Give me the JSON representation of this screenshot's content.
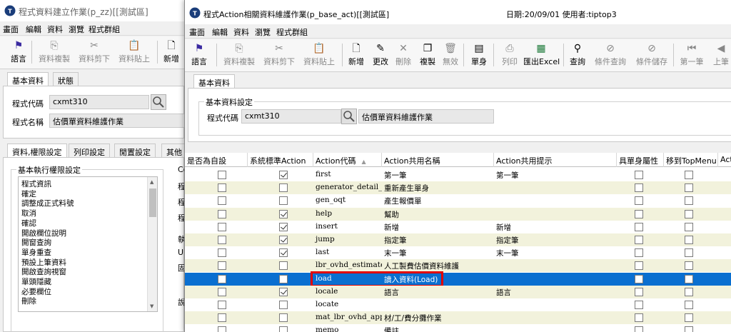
{
  "back_window": {
    "title": "程式資料建立作業(p_zz)[[測試區]",
    "menu": [
      "畫面",
      "編輯",
      "資料",
      "瀏覽",
      "程式群組"
    ],
    "toolbar": [
      {
        "label": "語言",
        "icon": "flag-icon"
      },
      {
        "label": "資料複製",
        "icon": "copy-icon"
      },
      {
        "label": "資料剪下",
        "icon": "cut-icon"
      },
      {
        "label": "資料貼上",
        "icon": "paste-icon"
      },
      {
        "label": "新增",
        "icon": "new-doc-icon"
      }
    ],
    "top_tabs": [
      "基本資料",
      "狀態"
    ],
    "program_code_label": "程式代碼",
    "program_code_value": "cxmt310",
    "program_name_label": "程式名稱",
    "program_name_value": "估價單資料維護作業",
    "lower_tabs": [
      "資料,權限設定",
      "列印設定",
      "閒置設定",
      "其他"
    ],
    "group_title": "基本執行權限設定",
    "permission_list": [
      "程式資訊",
      "確定",
      "調整成正式料號",
      "取消",
      "確認",
      "開啟欄位說明",
      "開窗查詢",
      "單身重查",
      "預設上筆資料",
      "開啟查詢視窗",
      "單頭隱藏",
      "必要欄位",
      "刪除"
    ],
    "side_labels": [
      "Co",
      "程",
      "程",
      "程",
      "執",
      "UI",
      "固",
      "說"
    ]
  },
  "front_window": {
    "title": "程式Action相關資料維護作業(p_base_act)[[測試區]",
    "date_user": "日期:20/09/01  使用者:tiptop3",
    "menu": [
      "畫面",
      "編輯",
      "資料",
      "瀏覽",
      "程式群組"
    ],
    "toolbar": [
      {
        "label": "語言",
        "icon": "flag-icon",
        "enabled": true
      },
      {
        "label": "資料複製",
        "icon": "copy-icon",
        "enabled": false
      },
      {
        "label": "資料剪下",
        "icon": "cut-icon",
        "enabled": false
      },
      {
        "label": "資料貼上",
        "icon": "paste-icon",
        "enabled": false
      },
      {
        "label": "新增",
        "icon": "new-doc-icon",
        "enabled": true
      },
      {
        "label": "更改",
        "icon": "pencil-icon",
        "enabled": true
      },
      {
        "label": "刪除",
        "icon": "x-icon",
        "enabled": false
      },
      {
        "label": "複製",
        "icon": "duplicate-icon",
        "enabled": true
      },
      {
        "label": "無效",
        "icon": "trash-icon",
        "enabled": false
      },
      {
        "label": "單身",
        "icon": "detail-icon",
        "enabled": true
      },
      {
        "label": "列印",
        "icon": "printer-icon",
        "enabled": false
      },
      {
        "label": "匯出Excel",
        "icon": "excel-icon",
        "enabled": true
      },
      {
        "label": "查詢",
        "icon": "binoculars-icon",
        "enabled": true
      },
      {
        "label": "條件查詢",
        "icon": "filter-icon",
        "enabled": false
      },
      {
        "label": "條件儲存",
        "icon": "filter-save-icon",
        "enabled": false
      },
      {
        "label": "第一筆",
        "icon": "first-icon",
        "enabled": false
      },
      {
        "label": "上筆",
        "icon": "prev-icon",
        "enabled": false
      }
    ],
    "tab": "基本資料",
    "group_title": "基本資料設定",
    "program_code_label": "程式代碼",
    "program_code_value": "cxmt310",
    "program_name_value": "估價單資料維護作業",
    "grid": {
      "columns": [
        "是否為自設",
        "系統標準Action",
        "Action代碼",
        "Action共用名稱",
        "Action共用提示",
        "具單身屬性",
        "移到TopMenu",
        "Acti"
      ],
      "sort_indicator": "▲",
      "rows": [
        {
          "custom": false,
          "std": true,
          "code": "first",
          "name": "第一筆",
          "hint": "第一筆",
          "detail": false,
          "top": false
        },
        {
          "custom": false,
          "std": false,
          "code": "generator_detail_agai",
          "name": "重新產生單身",
          "hint": "",
          "detail": false,
          "top": false
        },
        {
          "custom": false,
          "std": false,
          "code": "gen_oqt",
          "name": "產生報價單",
          "hint": "",
          "detail": false,
          "top": false
        },
        {
          "custom": false,
          "std": true,
          "code": "help",
          "name": "幫助",
          "hint": "",
          "detail": false,
          "top": false
        },
        {
          "custom": false,
          "std": true,
          "code": "insert",
          "name": "新增",
          "hint": "新增",
          "detail": false,
          "top": false
        },
        {
          "custom": false,
          "std": true,
          "code": "jump",
          "name": "指定筆",
          "hint": "指定筆",
          "detail": false,
          "top": false
        },
        {
          "custom": false,
          "std": true,
          "code": "last",
          "name": "末一筆",
          "hint": "末一筆",
          "detail": false,
          "top": false
        },
        {
          "custom": false,
          "std": false,
          "code": "lbr_ovhd_estimate",
          "name": "人工製費估價資料維護",
          "hint": "",
          "detail": false,
          "top": false
        },
        {
          "custom": false,
          "std": false,
          "code": "load",
          "name": "讀入資料(Load)",
          "hint": "",
          "detail": false,
          "top": false,
          "selected": true
        },
        {
          "custom": false,
          "std": true,
          "code": "locale",
          "name": "語言",
          "hint": "語言",
          "detail": false,
          "top": false
        },
        {
          "custom": false,
          "std": false,
          "code": "locate",
          "name": "",
          "hint": "",
          "detail": false,
          "top": false
        },
        {
          "custom": false,
          "std": false,
          "code": "mat_lbr_ovhd_apport",
          "name": "材/工/費分攤作業",
          "hint": "",
          "detail": false,
          "top": false
        },
        {
          "custom": false,
          "std": false,
          "code": "memo",
          "name": "備註",
          "hint": "",
          "detail": false,
          "top": false
        }
      ]
    }
  },
  "colors": {
    "selection": "#0a6fd0",
    "alt_row": "#f2f2dc",
    "highlight": "#e00000"
  }
}
